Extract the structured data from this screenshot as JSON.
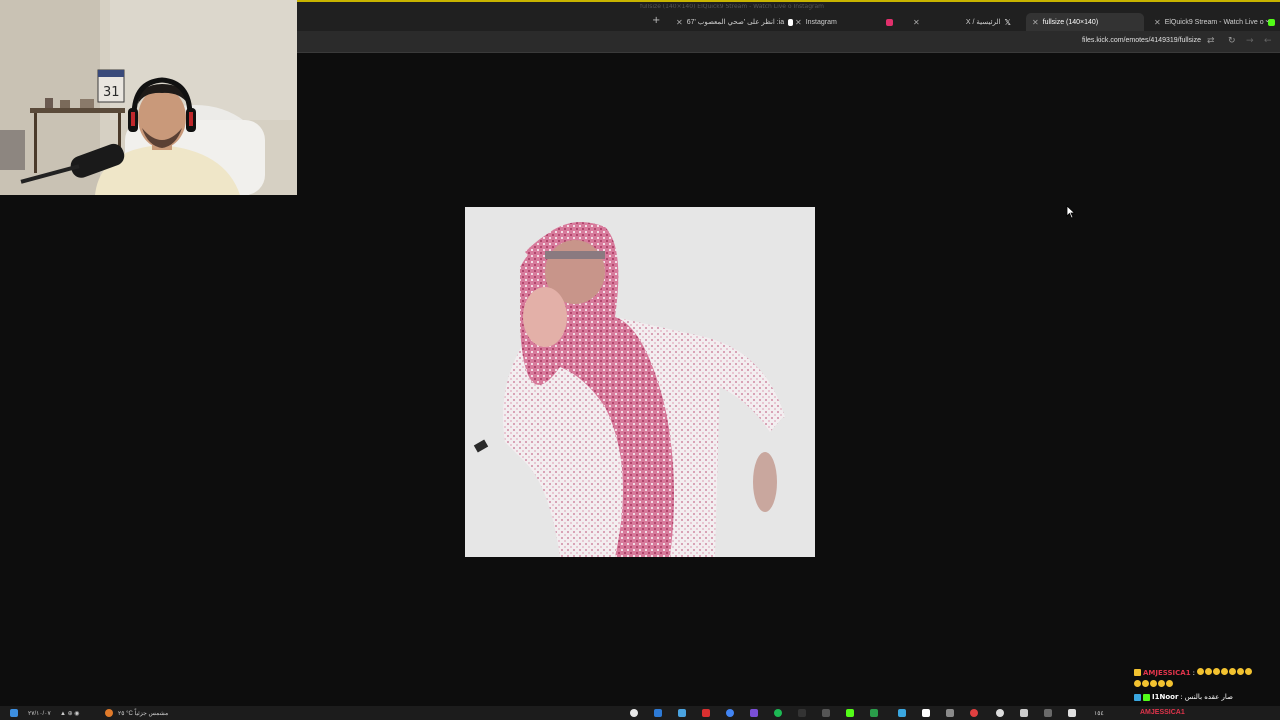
{
  "browser": {
    "tabs": [
      {
        "label": "ElQuick9 Stream - Watch Live o",
        "favicon_color": "#53fc18",
        "active": false
      },
      {
        "label": "fullsize (140×140)",
        "favicon_color": "#888888",
        "active": true
      },
      {
        "label": "X / الرئيسية",
        "favicon_color": "#ffffff",
        "active": false
      },
      {
        "label": "Instagram",
        "favicon_color": "#e1306c",
        "active": false
      },
      {
        "label": "انظر على 'صحي المعصوب '67 :ia",
        "favicon_color": "#ffffff",
        "active": false
      }
    ],
    "ghost_tabs_text": "fullsize (140×140)   ElQuick9 Stream - Watch Live o   Instagram",
    "new_tab_symbol": "+",
    "tab_list_symbol": "⌄",
    "url": "files.kick.com/emotes/4149319/fullsize",
    "nav": {
      "reload": "↻",
      "back": "←",
      "forward": "→",
      "translate": "⇄"
    }
  },
  "image": {
    "alt": "fullsize (140×140)",
    "background": "#e6e6e6"
  },
  "chat": {
    "messages": [
      {
        "user": "AMJESSICA1",
        "separator": ":",
        "text": "",
        "user_color": "#e0344b",
        "emoji_count": 12
      },
      {
        "user": "I1Noor",
        "separator": ":",
        "text": "صار عقده بالنس",
        "user_color": "#ffffff"
      }
    ]
  },
  "taskbar": {
    "start_icon": "windows-icon",
    "date": "٢٧/١٠/٠٧",
    "weather": "٢٥ °C مشمس جزئياً",
    "time": "١٥٤",
    "overlay_name": "AMJESSICA1"
  },
  "colors": {
    "page_bg": "#0d0d0d",
    "tabbar_bg": "#202020",
    "addressbar_bg": "#2b2b2b",
    "accent": "#c8b400"
  }
}
